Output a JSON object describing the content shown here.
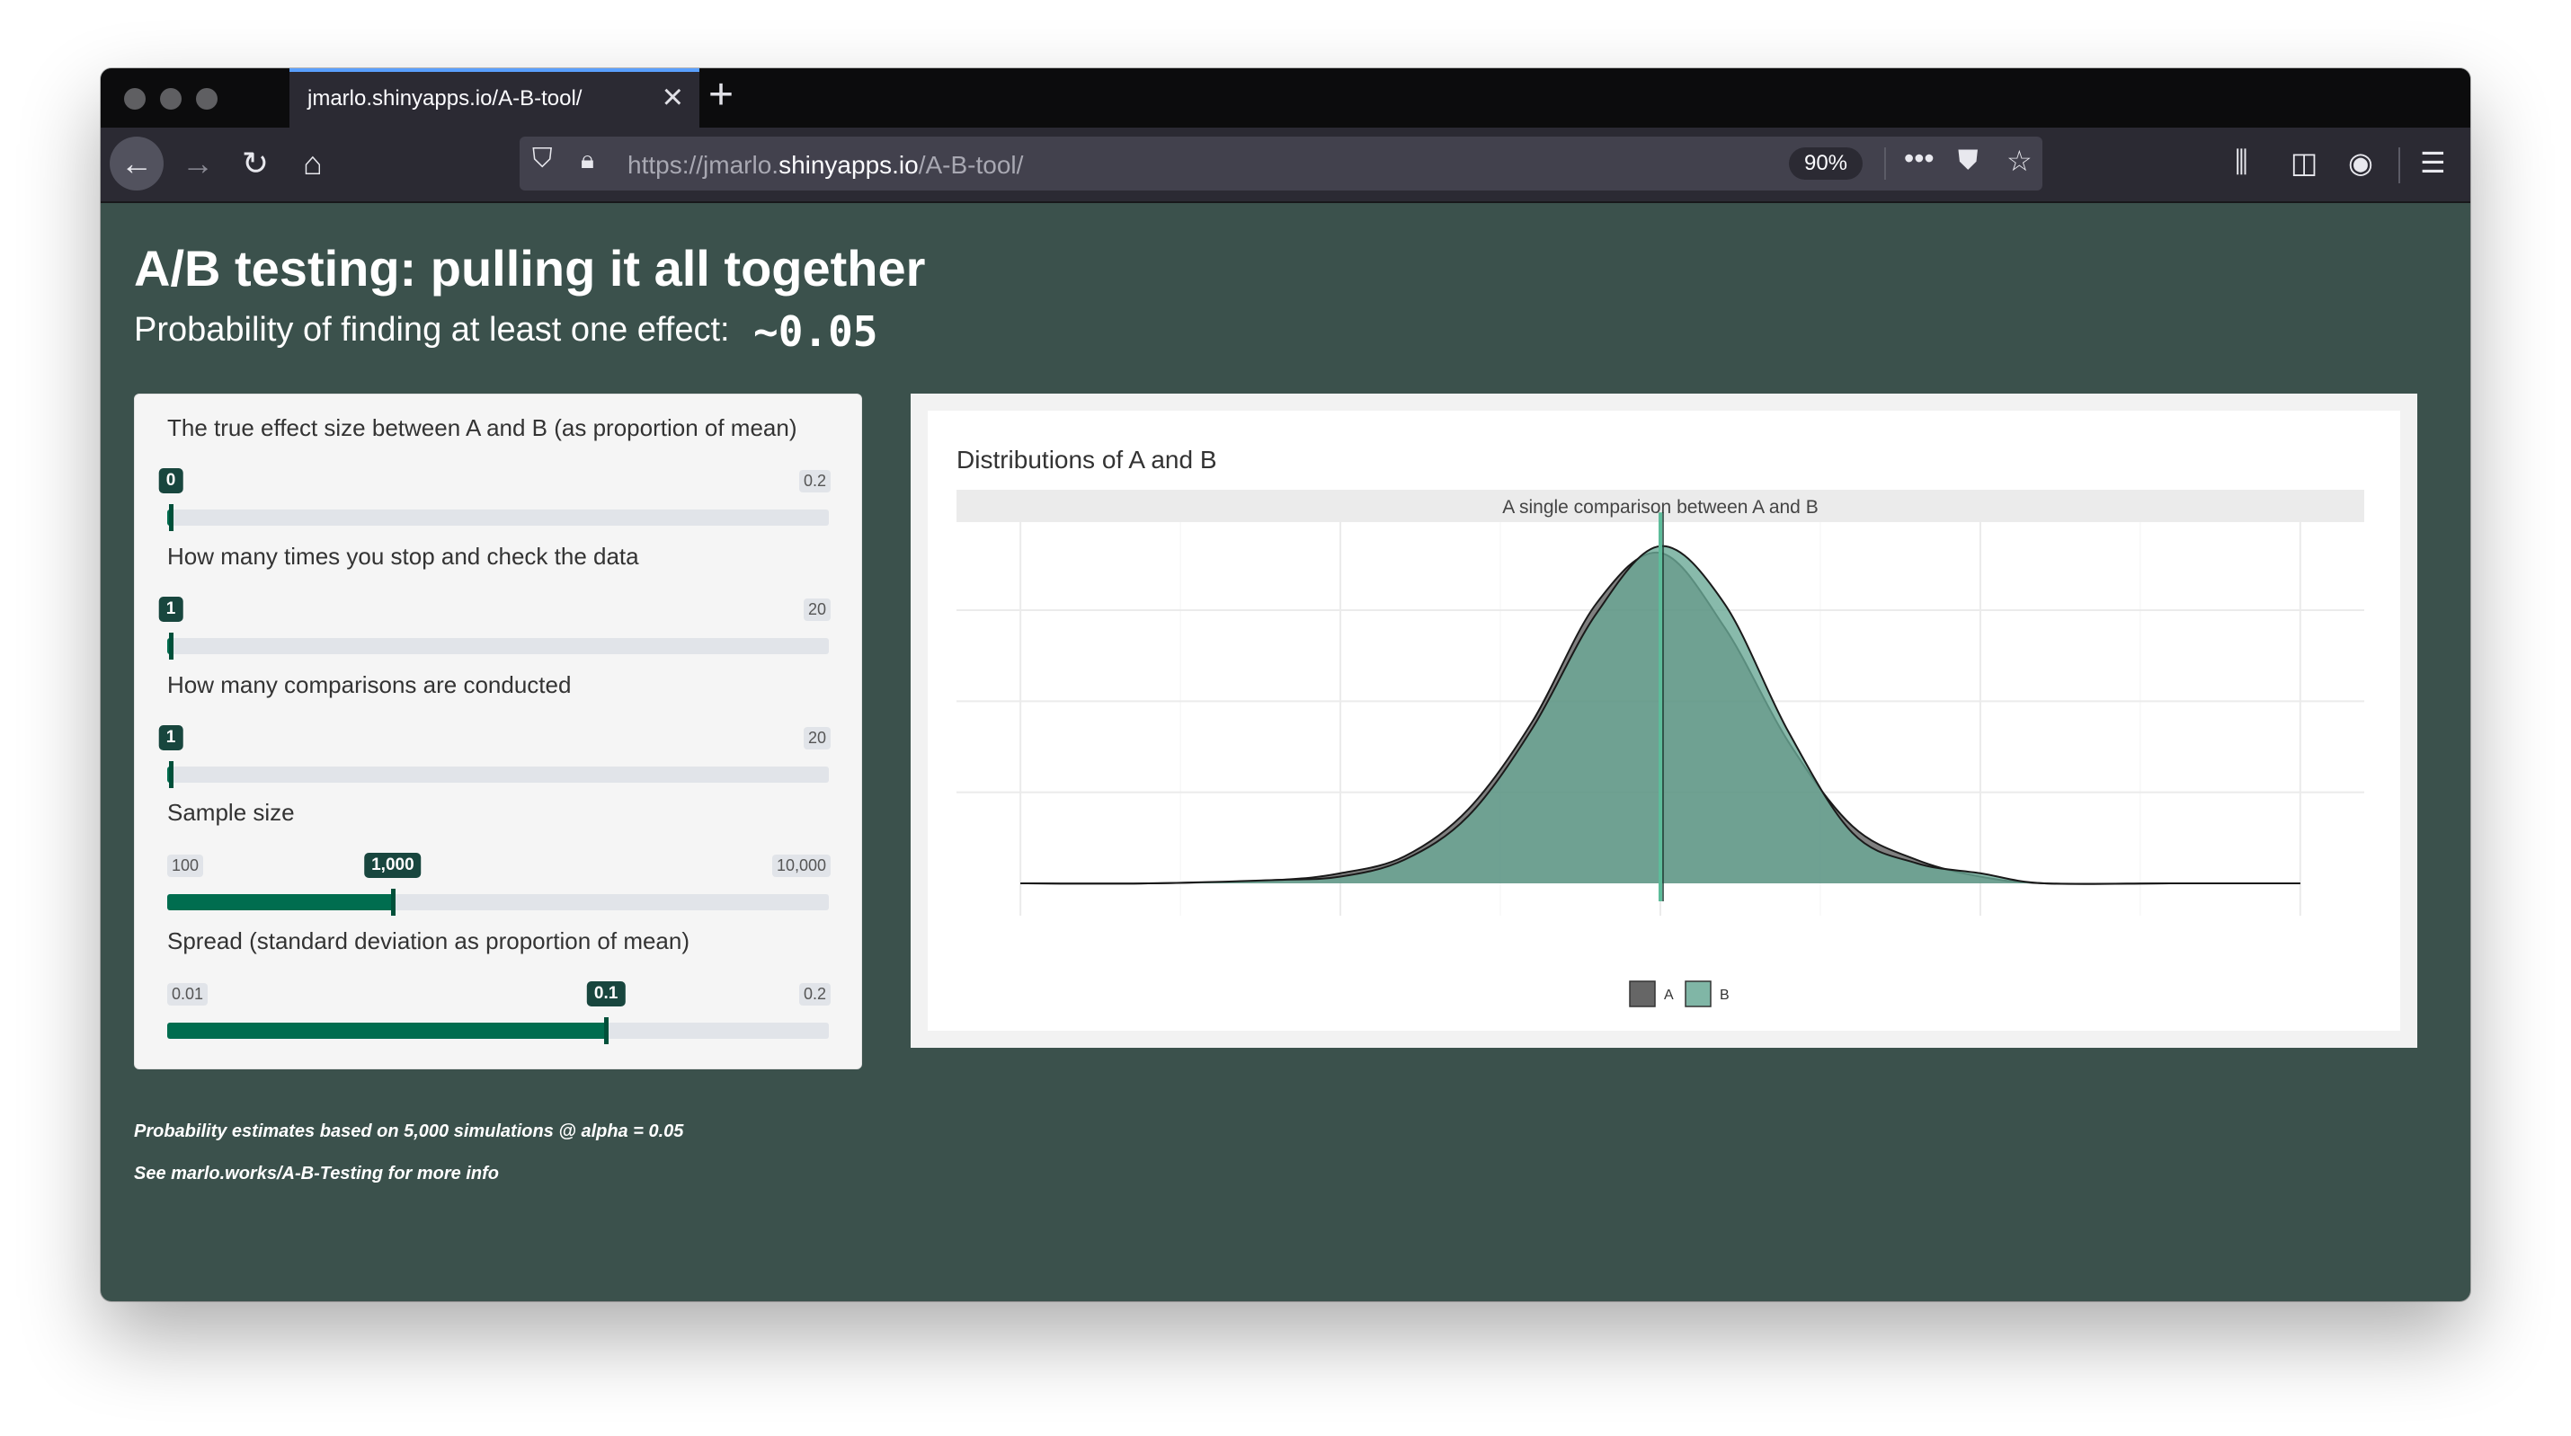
{
  "browser": {
    "tab_title": "jmarlo.shinyapps.io/A-B-tool/",
    "url_prefix": "https://jmarlo.",
    "url_domain": "shinyapps.io",
    "url_suffix": "/A-B-tool/",
    "zoom": "90%"
  },
  "page": {
    "title": "A/B testing: pulling it all together",
    "subtitle": "Probability of finding at least one effect:",
    "probability": "~0.05"
  },
  "controls": [
    {
      "label": "The true effect size between A and B (as proportion of mean)",
      "min": "0",
      "max": "0.2",
      "value": "0",
      "fraction": 0.0
    },
    {
      "label": "How many times you stop and check the data",
      "min": "1",
      "max": "20",
      "value": "1",
      "fraction": 0.0
    },
    {
      "label": "How many comparisons are conducted",
      "min": "1",
      "max": "20",
      "value": "1",
      "fraction": 0.0
    },
    {
      "label": "Sample size",
      "min": "100",
      "max": "10,000",
      "value": "1,000",
      "fraction": 0.3409
    },
    {
      "label": "Spread (standard deviation as proportion of mean)",
      "min": "0.01",
      "max": "0.2",
      "value": "0.1",
      "fraction": 0.6632
    }
  ],
  "notes": [
    "Probability estimates based on 5,000 simulations @ alpha = 0.05",
    "See marlo.works/A-B-Testing for more info"
  ],
  "chart_data": {
    "type": "area",
    "title": "Distributions of A and B",
    "facet_label": "A single comparison between A and B",
    "xlabel": "",
    "ylabel": "",
    "grid": true,
    "legend": "bottom",
    "legend_entries": [
      "A",
      "B"
    ],
    "colors": {
      "A": "#555555",
      "B": "#6aa996",
      "mean_line": "#5dbc9a"
    },
    "x": [
      -0.5,
      -0.4,
      -0.3,
      -0.25,
      -0.2,
      -0.15,
      -0.1,
      -0.05,
      0,
      0.05,
      0.1,
      0.15,
      0.2,
      0.25,
      0.3,
      0.4,
      0.5
    ],
    "series": [
      {
        "name": "A",
        "values": [
          0.0,
          0.0,
          0.01,
          0.03,
          0.08,
          0.22,
          0.48,
          0.83,
          0.98,
          0.76,
          0.42,
          0.17,
          0.07,
          0.02,
          0.0,
          0.0,
          0.0
        ]
      },
      {
        "name": "B",
        "values": [
          0.0,
          0.0,
          0.01,
          0.02,
          0.07,
          0.2,
          0.46,
          0.8,
          1.0,
          0.83,
          0.45,
          0.15,
          0.06,
          0.03,
          0.0,
          0.0,
          0.0
        ]
      }
    ],
    "xlim": [
      -0.5,
      0.5
    ],
    "ylim": [
      0,
      1.05
    ],
    "mean_line_x": 0.0
  }
}
